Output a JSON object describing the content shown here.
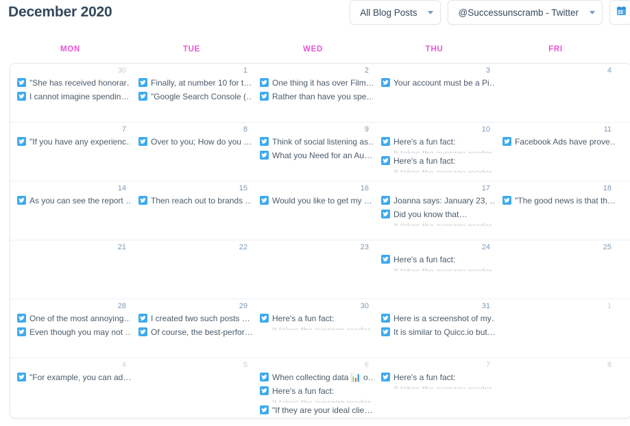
{
  "header": {
    "title": "December 2020",
    "filters": [
      {
        "label": "All Blog Posts",
        "icon": "chevron-down-icon"
      },
      {
        "label": "@Successunscramb - Twitter",
        "icon": "chevron-down-icon"
      }
    ],
    "calendar_icon": "calendar-icon"
  },
  "colors": {
    "weekday": "#ec53d8",
    "title": "#33475b",
    "twitter": "#3eaaed",
    "day_number": "#7c98b6",
    "day_number_muted": "#c6cfd8"
  },
  "weekdays": [
    "MON",
    "TUE",
    "WED",
    "THU",
    "FRI"
  ],
  "calendar": {
    "weeks": [
      {
        "days": [
          {
            "number": "30",
            "muted": true,
            "events": [
              {
                "icon": "twitter-icon",
                "text": "\"She has received honorar…"
              },
              {
                "icon": "twitter-icon",
                "text": "I cannot imagine spendin…"
              }
            ]
          },
          {
            "number": "1",
            "muted": false,
            "events": [
              {
                "icon": "twitter-icon",
                "text": "Finally, at number 10 for t…"
              },
              {
                "icon": "twitter-icon",
                "text": "\"Google Search Console (…"
              }
            ]
          },
          {
            "number": "2",
            "muted": false,
            "events": [
              {
                "icon": "twitter-icon",
                "text": "One thing it has over Film…"
              },
              {
                "icon": "twitter-icon",
                "text": "Rather than have you spe…"
              }
            ]
          },
          {
            "number": "3",
            "muted": false,
            "events": [
              {
                "icon": "twitter-icon",
                "text": "Your account must be a Pi…"
              }
            ]
          },
          {
            "number": "4",
            "muted": false,
            "events": []
          }
        ]
      },
      {
        "days": [
          {
            "number": "7",
            "muted": false,
            "events": [
              {
                "icon": "twitter-icon",
                "text": "\"If you have any experienc…"
              }
            ]
          },
          {
            "number": "8",
            "muted": false,
            "events": [
              {
                "icon": "twitter-icon",
                "text": "Over to you; How do you …"
              }
            ]
          },
          {
            "number": "9",
            "muted": false,
            "events": [
              {
                "icon": "twitter-icon",
                "text": "Think of social listening as…"
              },
              {
                "icon": "twitter-icon",
                "text": "What you Need for an Au…"
              }
            ]
          },
          {
            "number": "10",
            "muted": false,
            "events": [
              {
                "icon": "twitter-icon",
                "text": "Here's a fun fact:",
                "clipped": true
              },
              {
                "icon": "twitter-icon",
                "text": "Here's a fun fact:",
                "clipped": true
              }
            ]
          },
          {
            "number": "11",
            "muted": false,
            "events": [
              {
                "icon": "twitter-icon",
                "text": "Facebook Ads have prove…"
              }
            ]
          }
        ]
      },
      {
        "days": [
          {
            "number": "14",
            "muted": false,
            "events": [
              {
                "icon": "twitter-icon",
                "text": "As you can see the report …"
              }
            ]
          },
          {
            "number": "15",
            "muted": false,
            "events": [
              {
                "icon": "twitter-icon",
                "text": "Then reach out to brands …"
              }
            ]
          },
          {
            "number": "16",
            "muted": false,
            "events": [
              {
                "icon": "twitter-icon",
                "text": "Would you like to get my …"
              }
            ]
          },
          {
            "number": "17",
            "muted": false,
            "events": [
              {
                "icon": "twitter-icon",
                "text": "Joanna says: January 23, …"
              },
              {
                "icon": "twitter-icon",
                "text": "Did you know that…",
                "clipped": true
              }
            ]
          },
          {
            "number": "18",
            "muted": false,
            "events": [
              {
                "icon": "twitter-icon",
                "text": "\"The good news is that th…"
              }
            ]
          }
        ]
      },
      {
        "days": [
          {
            "number": "21",
            "muted": false,
            "events": []
          },
          {
            "number": "22",
            "muted": false,
            "events": []
          },
          {
            "number": "23",
            "muted": false,
            "events": []
          },
          {
            "number": "24",
            "muted": false,
            "events": [
              {
                "icon": "twitter-icon",
                "text": "Here's a fun fact:",
                "clipped": true
              }
            ]
          },
          {
            "number": "25",
            "muted": false,
            "events": []
          }
        ]
      },
      {
        "days": [
          {
            "number": "28",
            "muted": false,
            "events": [
              {
                "icon": "twitter-icon",
                "text": "One of the most annoying…"
              },
              {
                "icon": "twitter-icon",
                "text": "Even though you may not …"
              }
            ]
          },
          {
            "number": "29",
            "muted": false,
            "events": [
              {
                "icon": "twitter-icon",
                "text": "I created two such posts …"
              },
              {
                "icon": "twitter-icon",
                "text": "Of course, the best-perfor…"
              }
            ]
          },
          {
            "number": "30",
            "muted": false,
            "events": [
              {
                "icon": "twitter-icon",
                "text": "Here's a fun fact:",
                "clipped": true
              }
            ]
          },
          {
            "number": "31",
            "muted": false,
            "events": [
              {
                "icon": "twitter-icon",
                "text": "Here is a screenshot of my…"
              },
              {
                "icon": "twitter-icon",
                "text": "It is similar to Quicc.io but…"
              }
            ]
          },
          {
            "number": "1",
            "muted": true,
            "events": []
          }
        ]
      },
      {
        "days": [
          {
            "number": "4",
            "muted": true,
            "events": [
              {
                "icon": "twitter-icon",
                "text": "\"For example, you can ad…"
              }
            ]
          },
          {
            "number": "5",
            "muted": true,
            "events": []
          },
          {
            "number": "6",
            "muted": true,
            "events": [
              {
                "icon": "twitter-icon",
                "text": "When collecting data 📊 o…"
              },
              {
                "icon": "twitter-icon",
                "text": "Here's a fun fact:",
                "clipped": true
              },
              {
                "icon": "twitter-icon",
                "text": "\"If they are your ideal clie…"
              }
            ]
          },
          {
            "number": "7",
            "muted": true,
            "events": [
              {
                "icon": "twitter-icon",
                "text": "Here's a fun fact:",
                "clipped": true
              }
            ]
          },
          {
            "number": "8",
            "muted": true,
            "events": []
          }
        ]
      }
    ]
  }
}
